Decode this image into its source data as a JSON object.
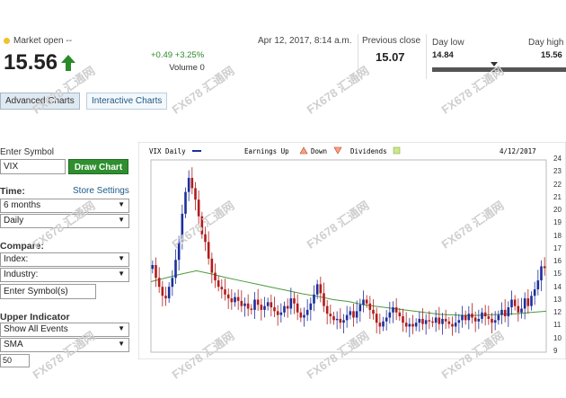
{
  "quote": {
    "status": "Market open --",
    "price": "15.56",
    "change": "+0.49 +3.25%",
    "volume": "Volume 0",
    "timestamp": "Apr 12, 2017, 8:14 a.m.",
    "previous_close_label": "Previous close",
    "previous_close": "15.07",
    "day_low_label": "Day low",
    "day_low": "14.84",
    "day_high_label": "Day high",
    "day_high": "15.56",
    "day_range_position": 0.46
  },
  "tabs": [
    {
      "label": "Advanced Charts",
      "active": true
    },
    {
      "label": "Interactive Charts",
      "active": false
    }
  ],
  "form": {
    "enter_symbol_label": "Enter Symbol",
    "symbol_value": "VIX",
    "draw_chart_label": "Draw Chart",
    "time_label": "Time:",
    "store_settings_label": "Store Settings",
    "time_range": "6 months",
    "interval": "Daily",
    "compare_label": "Compare:",
    "index_value": "Index:",
    "industry_value": "Industry:",
    "enter_symbols_placeholder": "Enter Symbol(s)",
    "upper_indicator_label": "Upper Indicator",
    "show_events": "Show All Events",
    "indicator": "SMA",
    "sma_period": "50"
  },
  "watermark": "FX678 汇通网",
  "colors": {
    "up": "#1c2f9c",
    "down": "#b31b1b",
    "sma": "#4a9a3c",
    "accent_green": "#2f8f2f",
    "link": "#1b5a8a"
  },
  "chart_data": {
    "type": "candlestick",
    "legend": {
      "series": "VIX Daily",
      "earnings": "Earnings Up",
      "down": "Down",
      "dividends": "Dividends",
      "date": "4/12/2017"
    },
    "yticks": [
      "24",
      "23",
      "22",
      "21",
      "20",
      "19",
      "18",
      "17",
      "16",
      "15",
      "14",
      "13",
      "12",
      "11",
      "10",
      "9"
    ],
    "ylim": [
      9,
      24
    ],
    "close": [
      15.8,
      14.8,
      14.1,
      13.4,
      13.2,
      14.1,
      14.8,
      16.2,
      17.6,
      19.8,
      21.5,
      22.6,
      21.8,
      20.9,
      19.6,
      18.2,
      17.6,
      16.3,
      15.2,
      14.6,
      14.1,
      13.9,
      13.5,
      13.2,
      12.9,
      13.3,
      13.0,
      12.6,
      12.8,
      12.4,
      12.3,
      13.1,
      12.7,
      12.3,
      12.6,
      12.9,
      12.5,
      12.2,
      11.9,
      12.1,
      12.6,
      12.4,
      13.2,
      12.8,
      12.1,
      11.7,
      11.9,
      12.3,
      12.8,
      13.5,
      14.3,
      13.6,
      12.6,
      12.0,
      11.8,
      11.5,
      11.6,
      11.3,
      11.5,
      11.9,
      12.2,
      11.7,
      12.2,
      12.7,
      13.1,
      12.8,
      12.3,
      12.0,
      11.3,
      11.0,
      11.4,
      11.7,
      12.1,
      12.5,
      12.1,
      11.8,
      11.3,
      11.0,
      11.2,
      11.0,
      11.3,
      11.6,
      11.2,
      11.5,
      11.4,
      11.3,
      11.7,
      11.2,
      11.6,
      11.4,
      11.2,
      11.0,
      11.3,
      11.5,
      11.9,
      11.5,
      12.0,
      11.7,
      11.4,
      11.6,
      12.1,
      11.8,
      11.6,
      11.3,
      11.5,
      11.9,
      12.3,
      11.8,
      12.5,
      13.1,
      12.6,
      12.1,
      12.4,
      13.2,
      12.6,
      13.4,
      13.9,
      14.6,
      15.7,
      15.56
    ],
    "sma": [
      14.5,
      14.8,
      15.1,
      15.35,
      15.1,
      14.8,
      14.55,
      14.3,
      14.05,
      13.8,
      13.55,
      13.35,
      13.1,
      12.95,
      12.7,
      12.55,
      12.4,
      12.25,
      12.1,
      11.95,
      11.9,
      11.85,
      11.9,
      11.95,
      12.0,
      12.1,
      12.2
    ]
  }
}
